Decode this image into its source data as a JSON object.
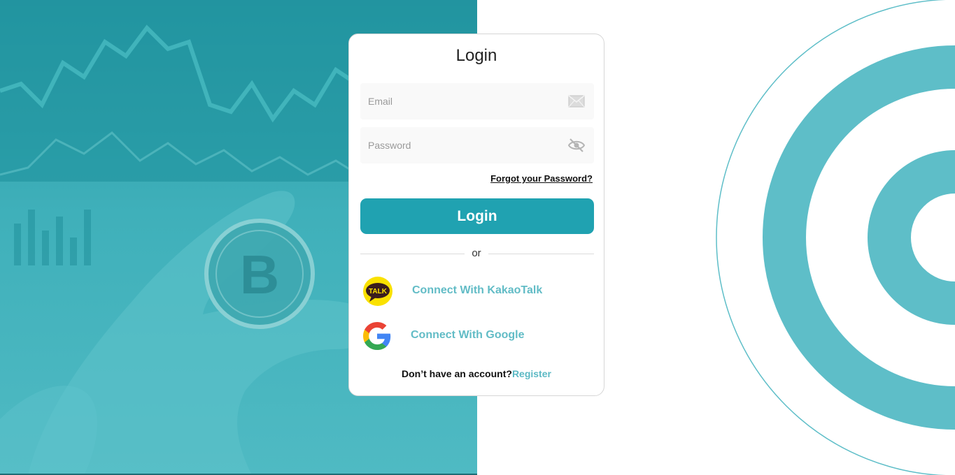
{
  "login": {
    "title": "Login",
    "email_placeholder": "Email",
    "password_placeholder": "Password",
    "forgot_label": "Forgot your Password?",
    "submit_label": "Login",
    "divider_label": "or"
  },
  "social": {
    "kakao_label": "Connect With KakaoTalk",
    "kakao_logo_text": "TALK",
    "google_label": "Connect With Google"
  },
  "footer": {
    "prompt": "Don’t have an account?",
    "register_label": "Register"
  },
  "colors": {
    "accent": "#20a2b1",
    "link": "#5cb9c4",
    "ring": "#5ebec8",
    "kakao_yellow": "#fae100"
  },
  "icons": {
    "email": "envelope-icon",
    "password": "eye-slash-icon",
    "kakao": "kakaotalk-logo",
    "google": "google-logo"
  }
}
